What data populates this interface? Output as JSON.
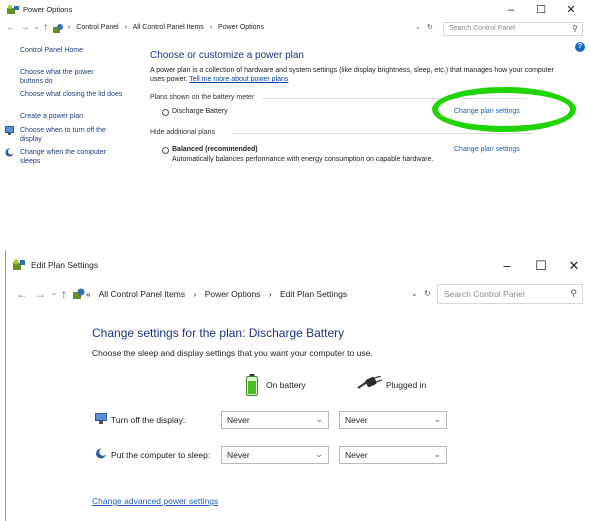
{
  "power_options": {
    "title": "Power Options",
    "controls": {
      "minimize": "–",
      "maximize": "☐",
      "close": "✕"
    },
    "nav": {
      "back": "←",
      "forward": "→",
      "up": "↑",
      "dropdown": "⌄",
      "refresh": "↻",
      "separator": "›"
    },
    "breadcrumb": [
      "Control Panel",
      "All Control Panel Items",
      "Power Options"
    ],
    "search_placeholder": "Search Control Panel",
    "help": "?",
    "sidebar": [
      {
        "label": "Control Panel Home"
      },
      {
        "label": "Choose what the power buttons do"
      },
      {
        "label": "Choose what closing the lid does"
      },
      {
        "label": "Create a power plan"
      },
      {
        "label": "Choose when to turn off the display",
        "icon": "monitor-icon"
      },
      {
        "label": "Change when the computer sleeps",
        "icon": "moon-icon"
      }
    ],
    "heading": "Choose or customize a power plan",
    "intro": "A power plan is a collection of hardware and system settings (like display brightness, sleep, etc.) that manages how your computer uses power.",
    "intro_link": "Tell me more about power plans",
    "group_battery_meter": "Plans shown on the battery meter",
    "plan1_name": "Discharge Battery",
    "plan1_link": "Change plan settings",
    "group_hidden": "Hide additional plans",
    "plan2_name": "Balanced (recommended)",
    "plan2_desc": "Automatically balances performance with energy consumption on capable hardware.",
    "plan2_link": "Change plan settings",
    "highlight_color": "#1fd400"
  },
  "edit_plan": {
    "title": "Edit Plan Settings",
    "controls": {
      "minimize": "–",
      "maximize": "☐",
      "close": "✕"
    },
    "nav": {
      "back": "←",
      "forward": "→",
      "up": "↑",
      "dropdown": "⌄",
      "refresh": "↻",
      "separator": "›",
      "overflow": "«"
    },
    "breadcrumb": [
      "All Control Panel Items",
      "Power Options",
      "Edit Plan Settings"
    ],
    "search_placeholder": "Search Control Panel",
    "heading": "Change settings for the plan: Discharge Battery",
    "subheading": "Choose the sleep and display settings that you want your computer to use.",
    "col_battery": "On battery",
    "col_plugged": "Plugged in",
    "rows": [
      {
        "label": "Turn off the display:",
        "battery": "Never",
        "plugged": "Never",
        "icon": "monitor-icon"
      },
      {
        "label": "Put the computer to sleep:",
        "battery": "Never",
        "plugged": "Never",
        "icon": "moon-icon"
      }
    ],
    "advanced_link": "Change advanced power settings",
    "chevron": "⌄"
  }
}
